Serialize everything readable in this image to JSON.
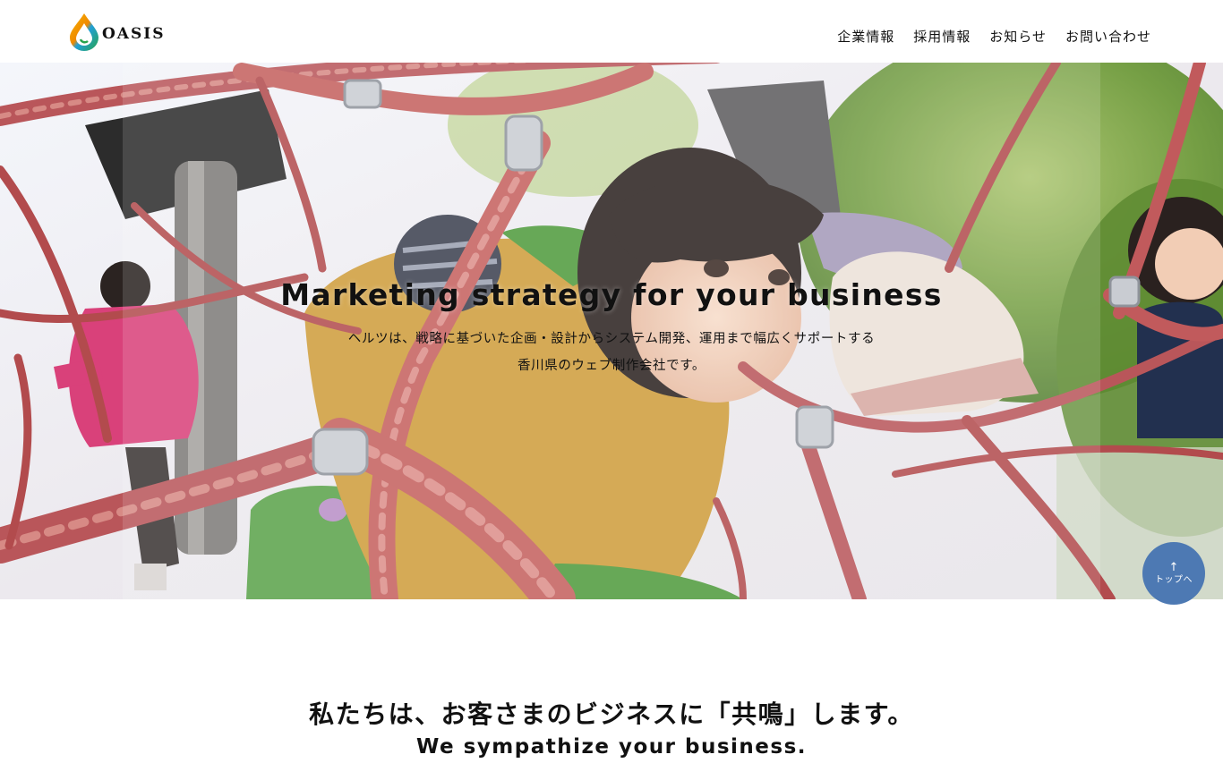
{
  "header": {
    "logo_text": "OASIS",
    "nav": [
      {
        "label": "企業情報"
      },
      {
        "label": "採用情報"
      },
      {
        "label": "お知らせ"
      },
      {
        "label": "お問い合わせ"
      }
    ]
  },
  "hero": {
    "title": "Marketing strategy for your business",
    "subtitle_line1": "ヘルツは、戦略に基づいた企画・設計からシステム開発、運用まで幅広くサポートする",
    "subtitle_line2": "香川県のウェブ制作会社です。",
    "image_icon": "playground-photo"
  },
  "to_top": {
    "arrow": "↑",
    "label": "トップへ"
  },
  "intro": {
    "heading_jp": "私たちは、お客さまのビジネスに「共鳴」します。",
    "heading_en": "We sympathize your business."
  },
  "colors": {
    "accent_blue": "#4d79b3",
    "rope_red": "#c0504d"
  }
}
